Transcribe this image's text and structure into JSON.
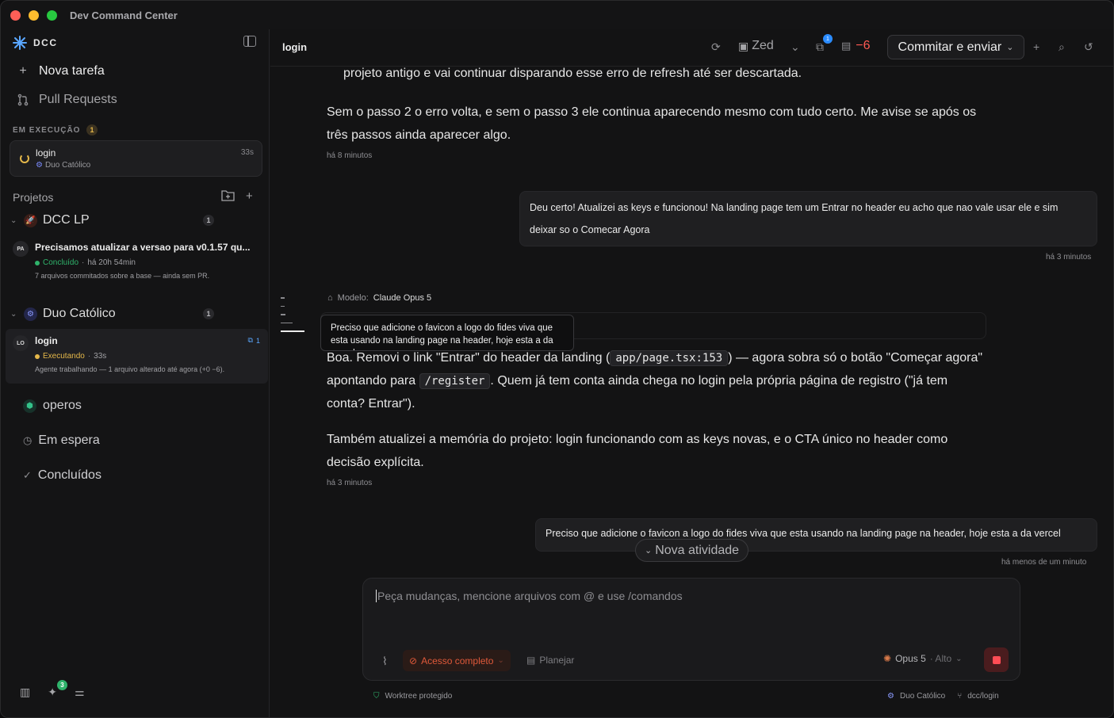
{
  "window": {
    "title": "Dev Command Center"
  },
  "sidebar": {
    "brand": "DCC",
    "nav": {
      "new_task": "Nova tarefa",
      "pull_requests": "Pull Requests"
    },
    "running": {
      "label": "EM EXECUÇÃO",
      "count": "1",
      "task": {
        "title": "login",
        "project": "Duo Católico",
        "elapsed": "33s"
      }
    },
    "projects_label": "Projetos",
    "projects": [
      {
        "name": "DCC LP",
        "count": "1",
        "task": {
          "avatar": "PA",
          "title": "Precisamos atualizar a versao para v0.1.57 qu...",
          "status": "Concluído",
          "time": "há 20h 54min",
          "desc": "7 arquivos commitados sobre a base — ainda sem PR."
        }
      },
      {
        "name": "Duo Católico",
        "count": "1",
        "task": {
          "avatar": "LO",
          "title": "login",
          "status": "Executando",
          "time": "33s",
          "desc": "Agente trabalhando — 1 arquivo alterado até agora (+0 −6).",
          "chip": "1"
        }
      }
    ],
    "other": {
      "operos": "operos",
      "waiting": "Em espera",
      "done": "Concluídos"
    },
    "bottom_badge": "3"
  },
  "header": {
    "tab": "login",
    "editor": "Zed",
    "pending_badge": "1",
    "changes": "−6",
    "commit_label": "Commitar e enviar"
  },
  "chat": {
    "partial_line": "projeto antigo e vai continuar disparando esse erro de refresh até ser descartada.",
    "msg1_line1": "Sem o passo 2 o erro volta, e sem o passo 3 ele continua aparecendo mesmo com tudo certo. Me avise se após os",
    "msg1_line2": "três passos ainda aparecer algo.",
    "msg1_time": "há 8 minutos",
    "user1_line1": "Deu certo! Atualizei as keys e funcionou! Na landing page tem um Entrar no header eu acho que nao vale usar ele e sim",
    "user1_line2": "deixar so o Comecar Agora",
    "user1_time": "há 3 minutos",
    "model_label": "Modelo:",
    "model_name": "Claude Opus 5",
    "tooltip": "Preciso que adicione o favicon a logo do fides viva que esta usando na landing page na header, hoje esta a da vercel",
    "msg2_pre": "Boa. Removi o link \"Entrar\" do header da landing (",
    "msg2_code1": "app/page.tsx:153",
    "msg2_mid": ") — agora sobra só o botão \"Começar agora\"",
    "msg2_l2_pre": "apontando para",
    "msg2_code2": "/register",
    "msg2_l2_post": ". Quem já tem conta ainda chega no login pela própria página de registro (\"já tem",
    "msg2_l3": "conta? Entrar\").",
    "msg3_line1": "Também atualizei a memória do projeto: login funcionando com as keys novas, e o CTA único no header como",
    "msg3_line2": "decisão explícita.",
    "msg3_time": "há 3 minutos",
    "user2": "Preciso que adicione o favicon a logo do fides viva que esta usando na landing page na header, hoje esta a da vercel",
    "user2_time": "há menos de um minuto",
    "new_activity": "Nova atividade"
  },
  "composer": {
    "placeholder": "Peça mudanças, mencione arquivos com @ e use /comandos",
    "access": "Acesso completo",
    "plan": "Planejar",
    "model": "Opus 5",
    "effort": "· Alto"
  },
  "footer": {
    "worktree": "Worktree protegido",
    "project": "Duo Católico",
    "branch": "dcc/login"
  },
  "colors": {
    "accent_blue": "#2b8cff",
    "danger": "#ff5a52",
    "running": "#e5b84a",
    "done": "#2fb36b"
  }
}
